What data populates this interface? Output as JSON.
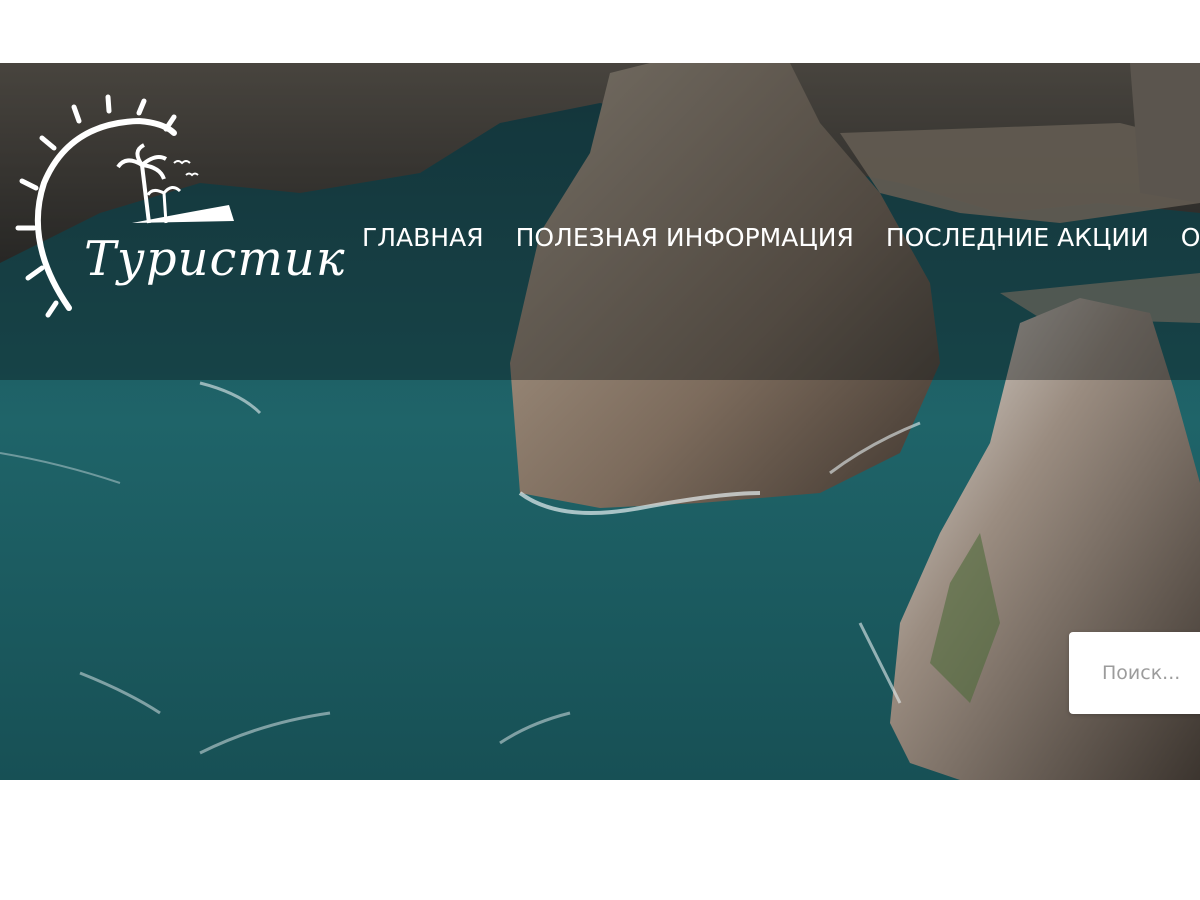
{
  "brand": {
    "logo_text": "Туристик"
  },
  "nav": {
    "items": [
      {
        "label": "ГЛАВНАЯ"
      },
      {
        "label": "ПОЛЕЗНАЯ ИНФОРМАЦИЯ"
      },
      {
        "label": "ПОСЛЕДНИЕ АКЦИИ"
      },
      {
        "label": "О С"
      }
    ]
  },
  "search": {
    "placeholder": "Поиск..."
  },
  "colors": {
    "sea": "#1d5a5e",
    "rock": "#8a7a6a",
    "header_overlay": "#0a1216",
    "text": "#ffffff"
  },
  "icons": {
    "logo": "sun-palm-logo-icon"
  }
}
